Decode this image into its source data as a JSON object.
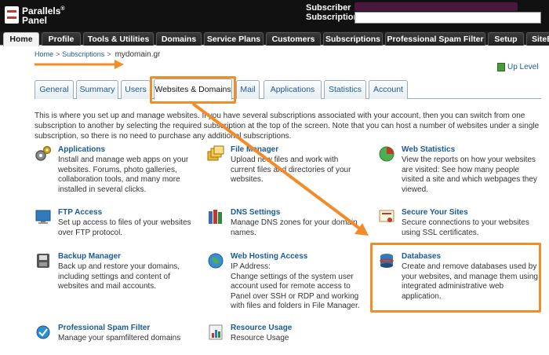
{
  "header": {
    "brand_line1": "Parallels",
    "brand_line2": "Panel",
    "brand_mark": "®",
    "subscriber_label": "Subscriber",
    "subscription_label": "Subscription"
  },
  "mainnav": {
    "tabs": [
      {
        "label": "Home",
        "active": true
      },
      {
        "label": "Profile",
        "active": false
      },
      {
        "label": "Tools & Utilities",
        "active": false
      },
      {
        "label": "Domains",
        "active": false
      },
      {
        "label": "Service Plans",
        "active": false
      },
      {
        "label": "Customers",
        "active": false
      },
      {
        "label": "Subscriptions",
        "active": false
      },
      {
        "label": "Professional Spam Filter",
        "active": false
      },
      {
        "label": "Setup",
        "active": false
      },
      {
        "label": "SiteBuilder",
        "active": false
      }
    ]
  },
  "breadcrumb": {
    "home": "Home",
    "subscriptions": "Subscriptions",
    "separator": ">",
    "current": "mydomain.gr"
  },
  "uplevel": {
    "label": "Up Level"
  },
  "subtabs": [
    {
      "label": "General",
      "active": false
    },
    {
      "label": "Summary",
      "active": false
    },
    {
      "label": "Users",
      "active": false
    },
    {
      "label": "Websites & Domains",
      "active": true
    },
    {
      "label": "Mail",
      "active": false
    },
    {
      "label": "Applications",
      "active": false
    },
    {
      "label": "Statistics",
      "active": false
    },
    {
      "label": "Account",
      "active": false
    }
  ],
  "intro": "This is where you set up and manage websites. If you have several subscriptions associated with your account, then you can switch from one subscription to another by selecting the required subscription at the top of the screen. Note that you can host a number of websites under a single subscription, so there is no need to purchase any additional subscriptions.",
  "items": {
    "applications": {
      "title": "Applications",
      "desc": "Install and manage web apps on your websites. Forums, photo galleries, collaboration tools, and many more installed in several clicks."
    },
    "file_manager": {
      "title": "File Manager",
      "desc": "Upload new files and work with current files and directories of your websites."
    },
    "web_statistics": {
      "title": "Web Statistics",
      "desc": "View the reports on how your websites are visited: See how many people visited a site and which webpages they viewed."
    },
    "ftp_access": {
      "title": "FTP Access",
      "desc": "Set up access to files of your websites over FTP protocol."
    },
    "dns_settings": {
      "title": "DNS Settings",
      "desc": "Manage DNS zones for your domain names."
    },
    "secure_sites": {
      "title": "Secure Your Sites",
      "desc": "Secure connections to your websites using SSL certificates."
    },
    "backup_manager": {
      "title": "Backup Manager",
      "desc": "Back up and restore your domains, including settings and content of websites and mail accounts."
    },
    "web_hosting_access": {
      "title": "Web Hosting Access",
      "desc": "IP Address:\nChange settings of the system user account used for remote access to Panel over SSH or RDP and working with files and folders in File Manager."
    },
    "databases": {
      "title": "Databases",
      "desc": "Create and remove databases used by your websites, and manage them using integrated administrative web application."
    },
    "spam_filter": {
      "title": "Professional Spam Filter",
      "desc": "Manage your spamfiltered domains"
    },
    "resource_usage": {
      "title": "Resource Usage",
      "desc": "Resource Usage"
    }
  },
  "colors": {
    "highlight": "#f28c28",
    "link": "#1a5a96",
    "header_bg": "#111111"
  }
}
